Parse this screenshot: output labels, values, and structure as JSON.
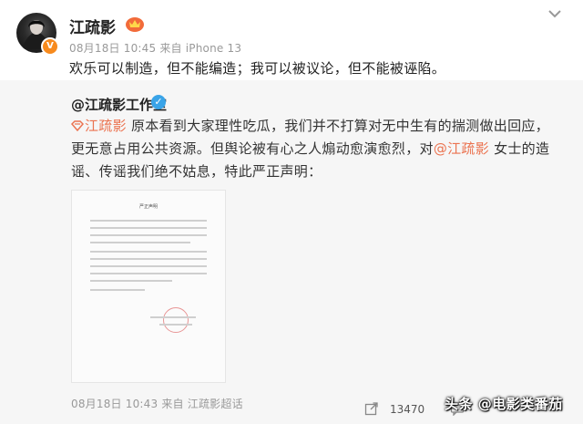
{
  "post": {
    "author": "江疏影",
    "meta": "08月18日 10:45  来自 iPhone 13",
    "text": "欢乐可以制造，但不能编造；我可以被议论，但不能被诬陷。"
  },
  "repost": {
    "author": "@江疏影工作室",
    "mention1": "江疏影",
    "text1": " 原本看到大家理性吃瓜，我们并不打算对无中生有的揣测做出回应，更无意占用公共资源。但舆论被有心之人煽动愈演愈烈，对",
    "mention2": "@江疏影",
    "text2": " 女士的造谣、传谣我们绝不姑息，特此严正声明：",
    "document_title": "严正声明",
    "footer": "08月18日 10:43  来自 江疏影超话",
    "share_count": "13470"
  },
  "watermark": "头条 @电影类番茄",
  "colors": {
    "mention": "#eb7350",
    "verified": "#3aa4e8",
    "meta": "#999999",
    "background_repost": "#f6f6f6"
  }
}
